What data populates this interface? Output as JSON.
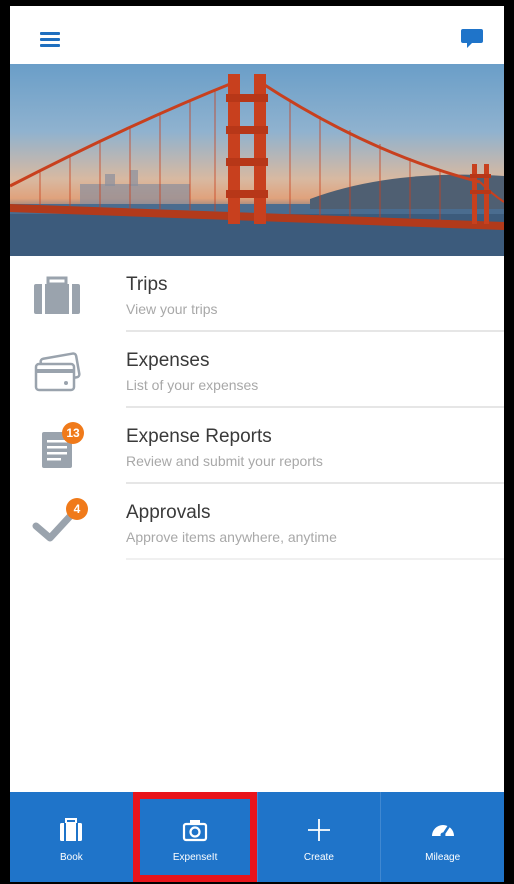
{
  "header": {
    "menu_icon": "menu-icon",
    "chat_icon": "chat-icon"
  },
  "colors": {
    "brand_blue": "#1f74c9",
    "badge_orange": "#f07a1a",
    "highlight_red": "#e8141b",
    "bridge_red": "#c8401e"
  },
  "list": {
    "items": [
      {
        "title": "Trips",
        "subtitle": "View your trips",
        "icon": "suitcase-icon"
      },
      {
        "title": "Expenses",
        "subtitle": "List of your expenses",
        "icon": "credit-card-icon"
      },
      {
        "title": "Expense Reports",
        "subtitle": "Review and submit your reports",
        "icon": "report-icon",
        "badge": "13"
      },
      {
        "title": "Approvals",
        "subtitle": "Approve items anywhere, anytime",
        "icon": "checkmark-icon",
        "badge": "4"
      }
    ]
  },
  "tabbar": {
    "tabs": [
      {
        "label": "Book",
        "icon": "suitcase-icon"
      },
      {
        "label": "ExpenseIt",
        "icon": "camera-icon",
        "highlighted": true
      },
      {
        "label": "Create",
        "icon": "plus-icon"
      },
      {
        "label": "Mileage",
        "icon": "gauge-icon"
      }
    ]
  }
}
